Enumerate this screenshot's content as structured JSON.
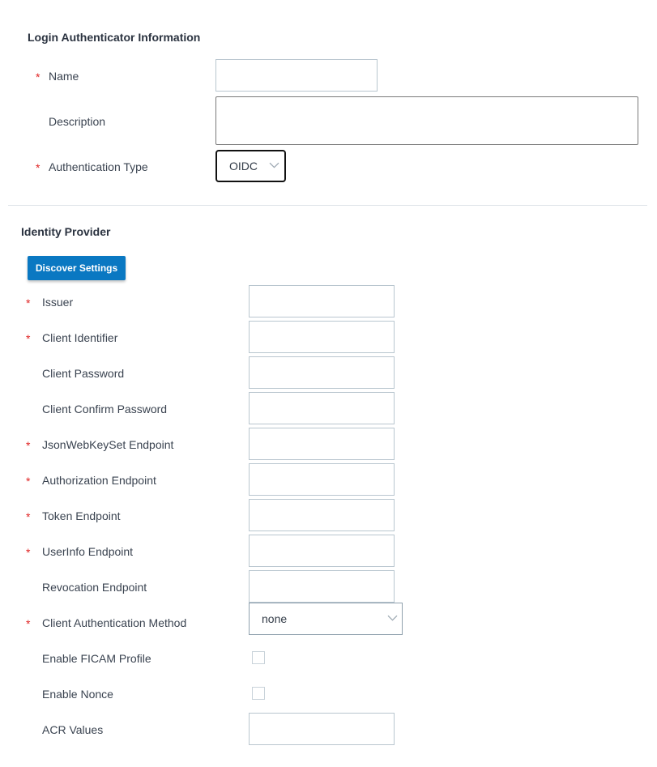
{
  "login_section": {
    "title": "Login Authenticator Information",
    "fields": {
      "name": {
        "label": "Name",
        "required": true,
        "value": ""
      },
      "description": {
        "label": "Description",
        "required": false,
        "value": ""
      },
      "auth_type": {
        "label": "Authentication Type",
        "required": true,
        "value": "OIDC"
      }
    }
  },
  "identity_provider": {
    "title": "Identity Provider",
    "discover_button": "Discover Settings",
    "fields": [
      {
        "label": "Issuer",
        "required": true,
        "type": "text",
        "value": ""
      },
      {
        "label": "Client Identifier",
        "required": true,
        "type": "text",
        "value": ""
      },
      {
        "label": "Client Password",
        "required": false,
        "type": "text",
        "value": ""
      },
      {
        "label": "Client Confirm Password",
        "required": false,
        "type": "text",
        "value": ""
      },
      {
        "label": "JsonWebKeySet Endpoint",
        "required": true,
        "type": "text",
        "value": ""
      },
      {
        "label": "Authorization Endpoint",
        "required": true,
        "type": "text",
        "value": ""
      },
      {
        "label": "Token Endpoint",
        "required": true,
        "type": "text",
        "value": ""
      },
      {
        "label": "UserInfo Endpoint",
        "required": true,
        "type": "text",
        "value": ""
      },
      {
        "label": "Revocation Endpoint",
        "required": false,
        "type": "text",
        "value": ""
      },
      {
        "label": "Client Authentication Method",
        "required": true,
        "type": "select",
        "value": "none"
      },
      {
        "label": "Enable FICAM Profile",
        "required": false,
        "type": "checkbox",
        "checked": false
      },
      {
        "label": "Enable Nonce",
        "required": false,
        "type": "checkbox",
        "checked": false
      },
      {
        "label": "ACR Values",
        "required": false,
        "type": "text",
        "value": ""
      }
    ]
  },
  "required_marker": "*",
  "colors": {
    "primary": "#0a78c2",
    "required": "#e02424"
  }
}
